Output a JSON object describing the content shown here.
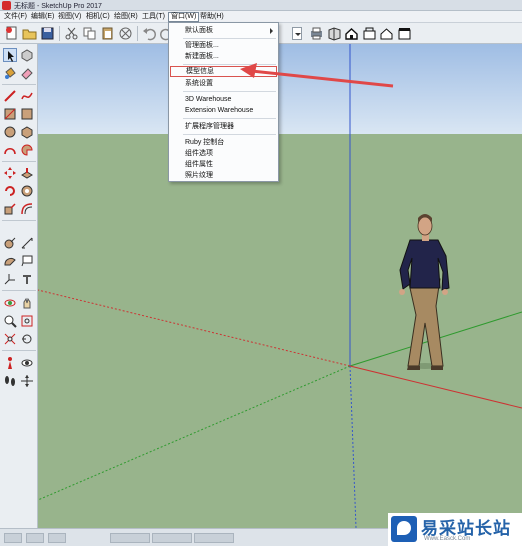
{
  "window": {
    "title": "无标题 - SketchUp Pro 2017"
  },
  "menubar": {
    "items": [
      "文件(F)",
      "编辑(E)",
      "视图(V)",
      "相机(C)",
      "绘图(R)",
      "工具(T)",
      "窗口(W)",
      "帮助(H)"
    ],
    "active": "窗口(W)"
  },
  "window_menu": {
    "items": [
      {
        "label": "默认面板",
        "submenu": true
      },
      {
        "label": "管理面板..."
      },
      {
        "label": "新建面板..."
      },
      {
        "label": "模型信息",
        "highlighted": true
      },
      {
        "label": "系统设置"
      },
      {
        "label": "3D Warehouse"
      },
      {
        "label": "Extension Warehouse"
      },
      {
        "label": "扩展程序管理器"
      },
      {
        "label": "Ruby 控制台"
      },
      {
        "label": "组件选项"
      },
      {
        "label": "组件属性"
      },
      {
        "label": "照片纹理"
      }
    ]
  },
  "watermark": {
    "title": "易采站长站",
    "subtitle": "Www.Easck.Com"
  },
  "colors": {
    "sky": "#c9daf0",
    "ground": "#98b48c",
    "highlight_box": "#d9534f",
    "annotation_arrow": "#e04848",
    "axis_red": "#c33",
    "axis_green": "#3a3",
    "axis_blue": "#3355cc"
  },
  "icons": {
    "toolbar": [
      "new-file-icon",
      "open-icon",
      "save-icon",
      "cut-icon",
      "copy-icon",
      "paste-icon",
      "erase-icon",
      "undo-icon",
      "redo-icon",
      "print-icon",
      "3d-warehouse-icon",
      "share-model-icon",
      "home-icon",
      "component-icon",
      "house-icon",
      "layout-icon"
    ],
    "left": [
      "select-icon",
      "component-icon",
      "paint-bucket-icon",
      "eraser-icon",
      "line-icon",
      "freehand-icon",
      "rectangle-icon",
      "rotated-rectangle-icon",
      "circle-icon",
      "polygon-icon",
      "arc-icon",
      "pie-icon",
      "move-icon",
      "push-pull-icon",
      "rotate-icon",
      "follow-me-icon",
      "scale-icon",
      "offset-icon",
      "tape-measure-icon",
      "dimension-icon",
      "protractor-icon",
      "text-icon",
      "axes-icon",
      "3d-text-icon",
      "orbit-icon",
      "pan-icon",
      "zoom-icon",
      "zoom-window-icon",
      "zoom-extents-icon",
      "previous-view-icon",
      "position-camera-icon",
      "look-around-icon",
      "walk-icon",
      "section-plane-icon"
    ]
  }
}
